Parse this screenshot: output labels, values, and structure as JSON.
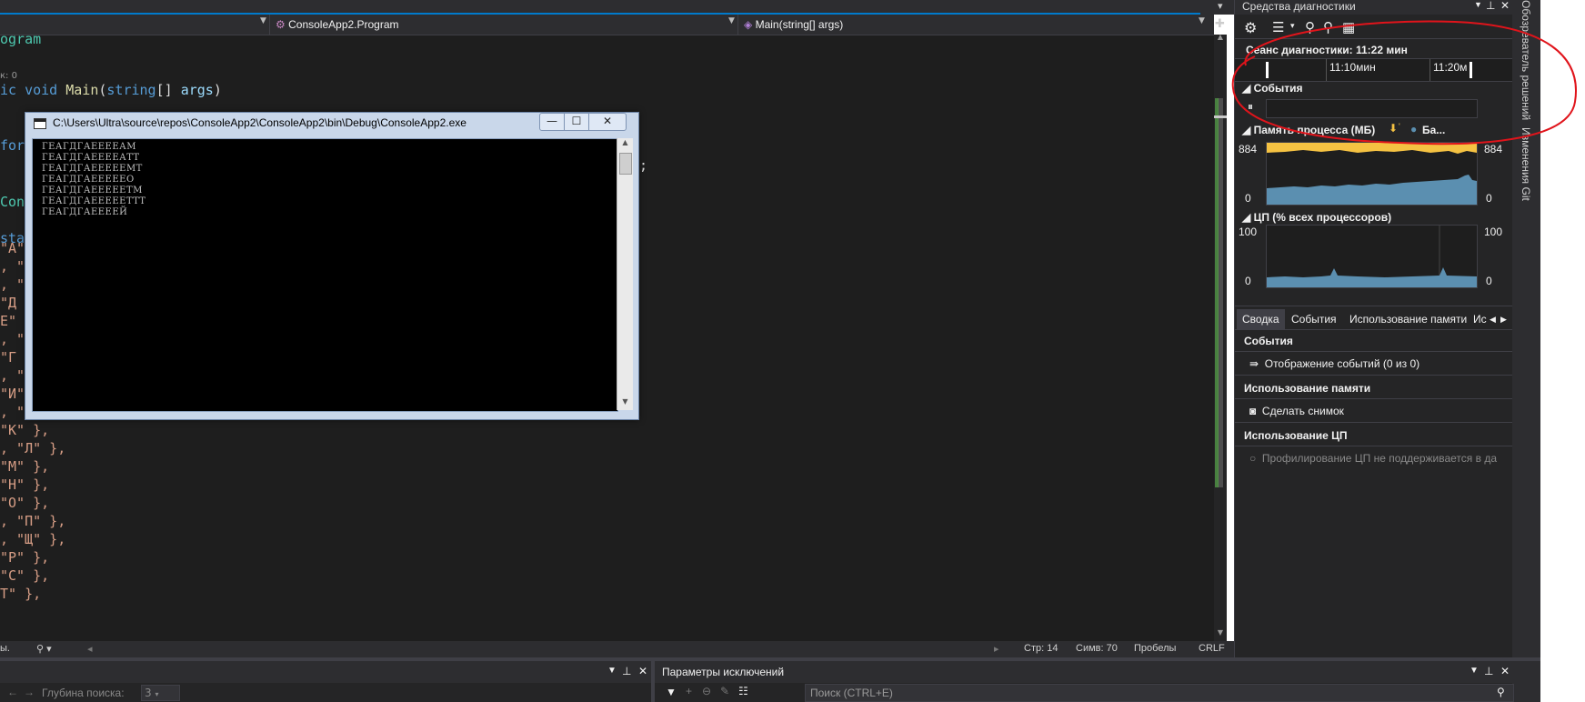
{
  "navbar": {
    "class_dropdown": "ConsoleApp2.Program",
    "method_dropdown": "Main(string[] args)"
  },
  "editor": {
    "line1": "ogram",
    "refs": "к: 0",
    "line_main_kw1": "ic",
    "line_main_kw2": "void",
    "line_main_fn": "Main",
    "line_main_open": "(",
    "line_main_type": "string",
    "line_main_br": "[]",
    "line_main_par": "args",
    "line_main_close": ")",
    "line_for": "for",
    "line_semi": ");",
    "line_cons": "Cons",
    "line_stat": "stat",
    "str_lines": [
      "\"А\"",
      ", \"\\",
      ", \"\\",
      "\"Д",
      "Е\"",
      ", \"(",
      "\"Г",
      ", \"'",
      "\"И\" },",
      ", \"Й\" },",
      "\"К\" },",
      ", \"Л\" },",
      "\"М\" },",
      "\"Н\" },",
      "\"О\" },",
      ", \"П\" },",
      ", \"Щ\" },",
      "\"Р\" },",
      "\"С\" },",
      "Т\" },"
    ]
  },
  "console": {
    "title": "C:\\Users\\Ultra\\source\\repos\\ConsoleApp2\\ConsoleApp2\\bin\\Debug\\ConsoleApp2.exe",
    "lines": [
      "ГЕАГДГАЕЕЕЕАМ",
      "ГЕАГДГАЕЕЕЕАТТ",
      "ГЕАГДГАЕЕЕЕЕМТ",
      "ГЕАГДГАЕЕЕЕЕО",
      "ГЕАГДГАЕЕЕЕЕТМ",
      "ГЕАГДГАЕЕЕЕЕТТТ",
      "ГЕАГДГАЕЕЕЕЙ"
    ],
    "minimize": "—",
    "maximize": "☐",
    "close": "✕"
  },
  "status": {
    "left": "ы.",
    "line": "Стр: 14",
    "col": "Симв: 70",
    "spaces": "Пробелы",
    "eol": "CRLF"
  },
  "bottom": {
    "search_depth_label": "Глубина поиска:",
    "search_depth_value": "3",
    "exceptions_title": "Параметры исключений",
    "search_placeholder": "Поиск (CTRL+E)"
  },
  "diag": {
    "title": "Средства диагностики",
    "session": "Сеанс диагностики: 11:22 мин",
    "tick1": "11:10мин",
    "tick2": "11:20м",
    "events_header": "События",
    "memory_header": "Память процесса (МБ)",
    "memory_legend": "Ба...",
    "memory_max_left": "884",
    "memory_max_right": "884",
    "memory_min_left": "0",
    "memory_min_right": "0",
    "cpu_header": "ЦП (% всех процессоров)",
    "cpu_max_left": "100",
    "cpu_max_right": "100",
    "cpu_min_left": "0",
    "cpu_min_right": "0",
    "tabs": [
      "Сводка",
      "События",
      "Использование памяти",
      "Ис"
    ],
    "sec_events": "События",
    "events_item": "Отображение событий (0 из 0)",
    "sec_memory": "Использование памяти",
    "memory_item": "Сделать снимок",
    "sec_cpu": "Использование ЦП",
    "cpu_item": "Профилирование ЦП не поддерживается в да"
  },
  "side": {
    "solution_explorer": "Обозреватель решений",
    "git_changes": "Изменения Git"
  },
  "colors": {
    "annotation": "#e0141b",
    "memory_fill": "#5b8fb0",
    "gc_yellow": "#f5c242",
    "accent": "#007acc"
  }
}
